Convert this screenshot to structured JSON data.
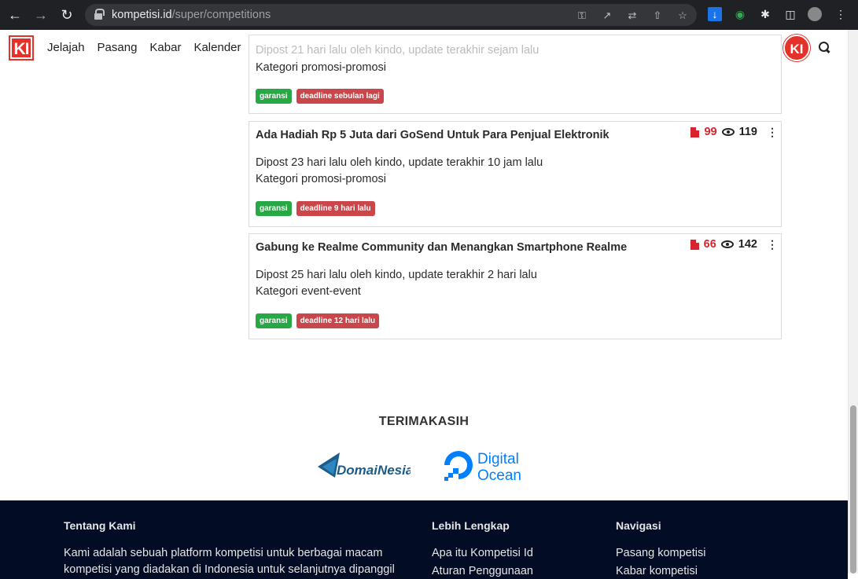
{
  "browser": {
    "url_domain": "kompetisi.id",
    "url_path": "/super/competitions"
  },
  "header": {
    "logo": "KI",
    "nav": [
      "Jelajah",
      "Pasang",
      "Kabar",
      "Kalender"
    ],
    "avatar": "KI"
  },
  "partial_card": {
    "meta": "Dipost 21 hari lalu oleh kindo, update terakhir sejam lalu",
    "category": "Kategori promosi-promosi",
    "badges": [
      "garansi",
      "deadline sebulan lagi"
    ]
  },
  "cards": [
    {
      "title": "Ada Hadiah Rp 5 Juta dari GoSend Untuk Para Penjual Elektronik",
      "red_count": "99",
      "views": "119",
      "meta": "Dipost 23 hari lalu oleh kindo, update terakhir 10 jam lalu",
      "category": "Kategori promosi-promosi",
      "badges": [
        "garansi",
        "deadline 9 hari lalu"
      ]
    },
    {
      "title": "Gabung ke Realme Community dan Menangkan Smartphone Realme",
      "red_count": "66",
      "views": "142",
      "meta": "Dipost 25 hari lalu oleh kindo, update terakhir 2 hari lalu",
      "category": "Kategori event-event",
      "badges": [
        "garansi",
        "deadline 12 hari lalu"
      ]
    }
  ],
  "thanks": {
    "title": "TERIMAKASIH",
    "sponsors": [
      "DomaiNesia",
      "Digital",
      "Ocean"
    ]
  },
  "footer": {
    "about_title": "Tentang Kami",
    "about_text_1": "Kami adalah sebuah platform kompetisi untuk berbagai macam",
    "about_text_2": "kompetisi yang diadakan di Indonesia untuk selanjutnya dipanggil",
    "more_title": "Lebih Lengkap",
    "more_links": [
      "Apa itu Kompetisi Id",
      "Aturan Penggunaan"
    ],
    "nav_title": "Navigasi",
    "nav_links": [
      "Pasang kompetisi",
      "Kabar kompetisi"
    ]
  },
  "colors": {
    "brand_red": "#e4322b",
    "badge_green": "#28a745",
    "badge_red": "#c9464a",
    "footer_bg": "#020c24"
  }
}
